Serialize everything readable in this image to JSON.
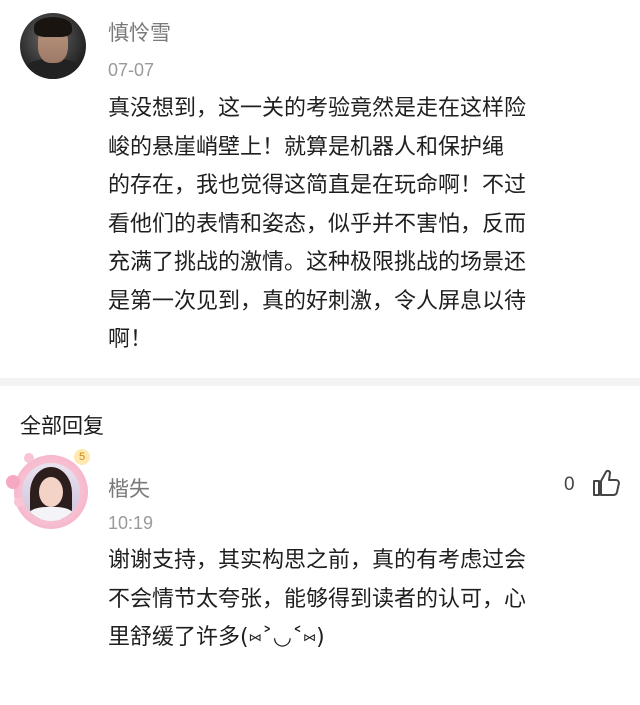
{
  "post": {
    "author": "慎怜雪",
    "date": "07-07",
    "lines": [
      "真没想到，这一关的考验竟然是走在这样险",
      "峻的悬崖峭壁上！就算是机器人和保护绳",
      "的存在，我也觉得这简直是在玩命啊！不过",
      "看他们的表情和姿态，似乎并不害怕，反而",
      "充满了挑战的激情。这种极限挑战的场景还",
      "是第一次见到，真的好刺激，令人屏息以待",
      "啊！"
    ]
  },
  "replies_section": {
    "title": "全部回复"
  },
  "reply": {
    "author": "楷失",
    "date": "10:19",
    "badge": "5",
    "likes": "0",
    "lines": [
      "谢谢支持，其实构思之前，真的有考虑过会",
      "不会情节太夸张，能够得到读者的认可，心",
      "里舒缓了许多(⑅˃◡˂⑅)"
    ]
  },
  "icons": {
    "like": "thumbs-up-icon"
  }
}
